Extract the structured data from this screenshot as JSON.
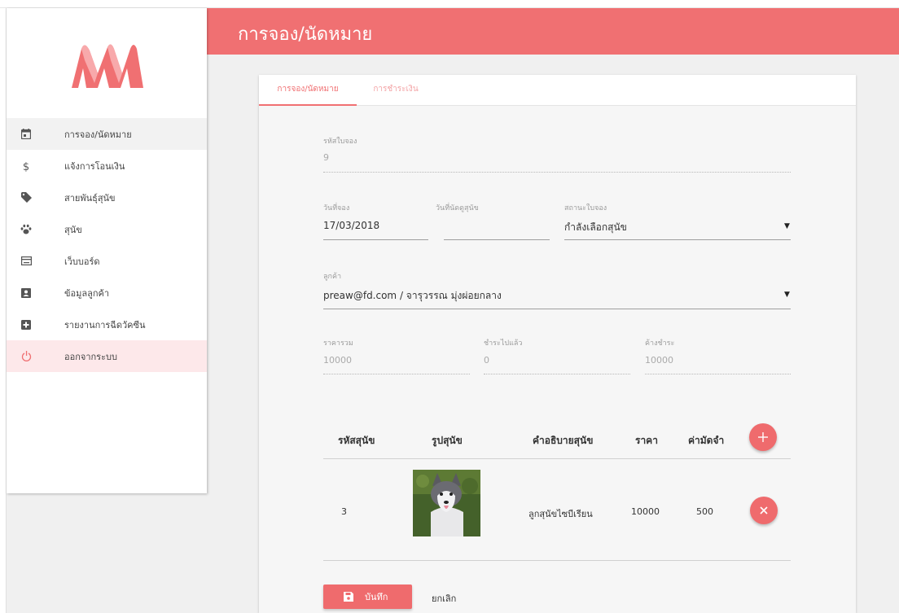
{
  "header": {
    "title": "การจอง/นัดหมาย"
  },
  "sidebar": {
    "items": [
      {
        "label": "การจอง/นัดหมาย",
        "icon": "calendar-icon"
      },
      {
        "label": "แจ้งการโอนเงิน",
        "icon": "dollar-icon"
      },
      {
        "label": "สายพันธุ์สุนัข",
        "icon": "tag-icon"
      },
      {
        "label": "สุนัข",
        "icon": "paw-icon"
      },
      {
        "label": "เว็บบอร์ด",
        "icon": "webboard-icon"
      },
      {
        "label": "ข้อมูลลูกค้า",
        "icon": "user-box-icon"
      },
      {
        "label": "รายงานการฉีดวัคซีน",
        "icon": "plus-box-icon"
      },
      {
        "label": "ออกจากระบบ",
        "icon": "power-icon"
      }
    ]
  },
  "tabs": [
    {
      "label": "การจอง/นัดหมาย"
    },
    {
      "label": "การชำระเงิน"
    }
  ],
  "form": {
    "booking_id": {
      "label": "รหัสใบจอง",
      "value": "9"
    },
    "booking_date": {
      "label": "วันที่จอง",
      "value": "17/03/2018"
    },
    "appointment_date": {
      "label": "วันที่นัดดูสุนัข",
      "value": ""
    },
    "status": {
      "label": "สถานะใบจอง",
      "value": "กำลังเลือกสุนัข"
    },
    "customer": {
      "label": "ลูกค้า",
      "value": "preaw@fd.com / จารุวรรณ มุ่งผ่อยกลาง"
    },
    "total": {
      "label": "ราคารวม",
      "value": "10000"
    },
    "paid": {
      "label": "ชำระไปแล้ว",
      "value": "0"
    },
    "outstanding": {
      "label": "ค้างชำระ",
      "value": "10000"
    }
  },
  "table": {
    "headers": [
      "รหัสสุนัข",
      "รูปสุนัข",
      "คำอธิบายสุนัข",
      "ราคา",
      "ค่ามัดจำ"
    ],
    "rows": [
      {
        "dog_id": "3",
        "image": "husky-puppy-photo",
        "description": "ลูกสุนัขไซบีเรียน",
        "price": "10000",
        "deposit": "500"
      }
    ]
  },
  "actions": {
    "save_label": "บันทึก",
    "cancel_label": "ยกเลิก"
  },
  "colors": {
    "accent": "#f07072",
    "accent_light": "#fde8ea",
    "button": "#ef6b6d"
  }
}
